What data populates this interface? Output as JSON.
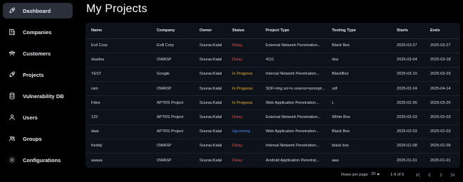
{
  "sidebar": {
    "items": [
      {
        "label": "Dashboard",
        "icon": "rocket-icon",
        "active": true
      },
      {
        "label": "Companies",
        "icon": "building-icon",
        "active": false
      },
      {
        "label": "Customers",
        "icon": "users-icon",
        "active": false
      },
      {
        "label": "Projects",
        "icon": "rocket-icon",
        "active": false
      },
      {
        "label": "Vulnerability DB",
        "icon": "database-icon",
        "active": false
      },
      {
        "label": "Users",
        "icon": "user-icon",
        "active": false
      },
      {
        "label": "Groups",
        "icon": "group-icon",
        "active": false
      },
      {
        "label": "Configurations",
        "icon": "gear-icon",
        "active": false
      }
    ]
  },
  "main": {
    "title": "My Projects"
  },
  "table": {
    "columns": [
      "Name",
      "Company",
      "Owner",
      "Status",
      "Project Type",
      "Testing Type",
      "Starts",
      "Ends"
    ],
    "rows": [
      [
        "Evil Corp",
        "Evill Corp",
        "Sourav.Kalal",
        "Delay",
        "External Network Penetration...",
        "Black Box",
        "2025-03-27",
        "2025-03-27"
      ],
      [
        "dsadsa",
        "OWASP",
        "Sourav.Kalal",
        "Delay",
        "4111",
        "dsa",
        "2025-03-04",
        "2025-03-18"
      ],
      [
        "TEST",
        "Google",
        "Sourav.Kalal",
        "In Progress",
        "Internal Network Penetration...",
        "BlackBox",
        "2025-03-10",
        "2025-03-29"
      ],
      [
        "ram",
        "OWASP",
        "Sourav.Kalal",
        "In Progress",
        "SDF<img src=x onerror=prompt...",
        "sdf",
        "2025-02-24",
        "2025-04-14"
      ],
      [
        "Fdee",
        "APTRS Project",
        "Sourav.Kalal",
        "In Progress",
        "Web Application Penetration...",
        "L",
        "2025-02-26",
        "2025-03-26"
      ],
      [
        "122",
        "APTRS Project",
        "Sourav.Kalal",
        "Delay",
        "External Network Penetration...",
        "White Box",
        "2025-02-03",
        "2025-02-03"
      ],
      [
        "daai",
        "APTRS Project",
        "Sourav.Kalal",
        "Upcoming",
        "Web Application Penetration...",
        "Black Box",
        "2025-02-03",
        "2025-02-03"
      ],
      [
        "freddy",
        "OWASP",
        "Sourav.Kalal",
        "Delay",
        "Internal Network Penetration...",
        "black box",
        "2025-01-08",
        "2025-01-09"
      ],
      [
        "aaaaa",
        "OWASP",
        "Sourav.Kalal",
        "Delay",
        "Android Application Penetrat...",
        "aaa",
        "2025-01-01",
        "2025-01-01"
      ]
    ]
  },
  "pagination": {
    "rows_per_page_label": "Rows per page",
    "rows_per_page_value": "20",
    "range_text": "1-9 of 9"
  },
  "colors": {
    "delay": "#e5534b",
    "in_progress": "#e3b341",
    "upcoming": "#4a8eea",
    "active_nav": "#2a2f3a"
  }
}
